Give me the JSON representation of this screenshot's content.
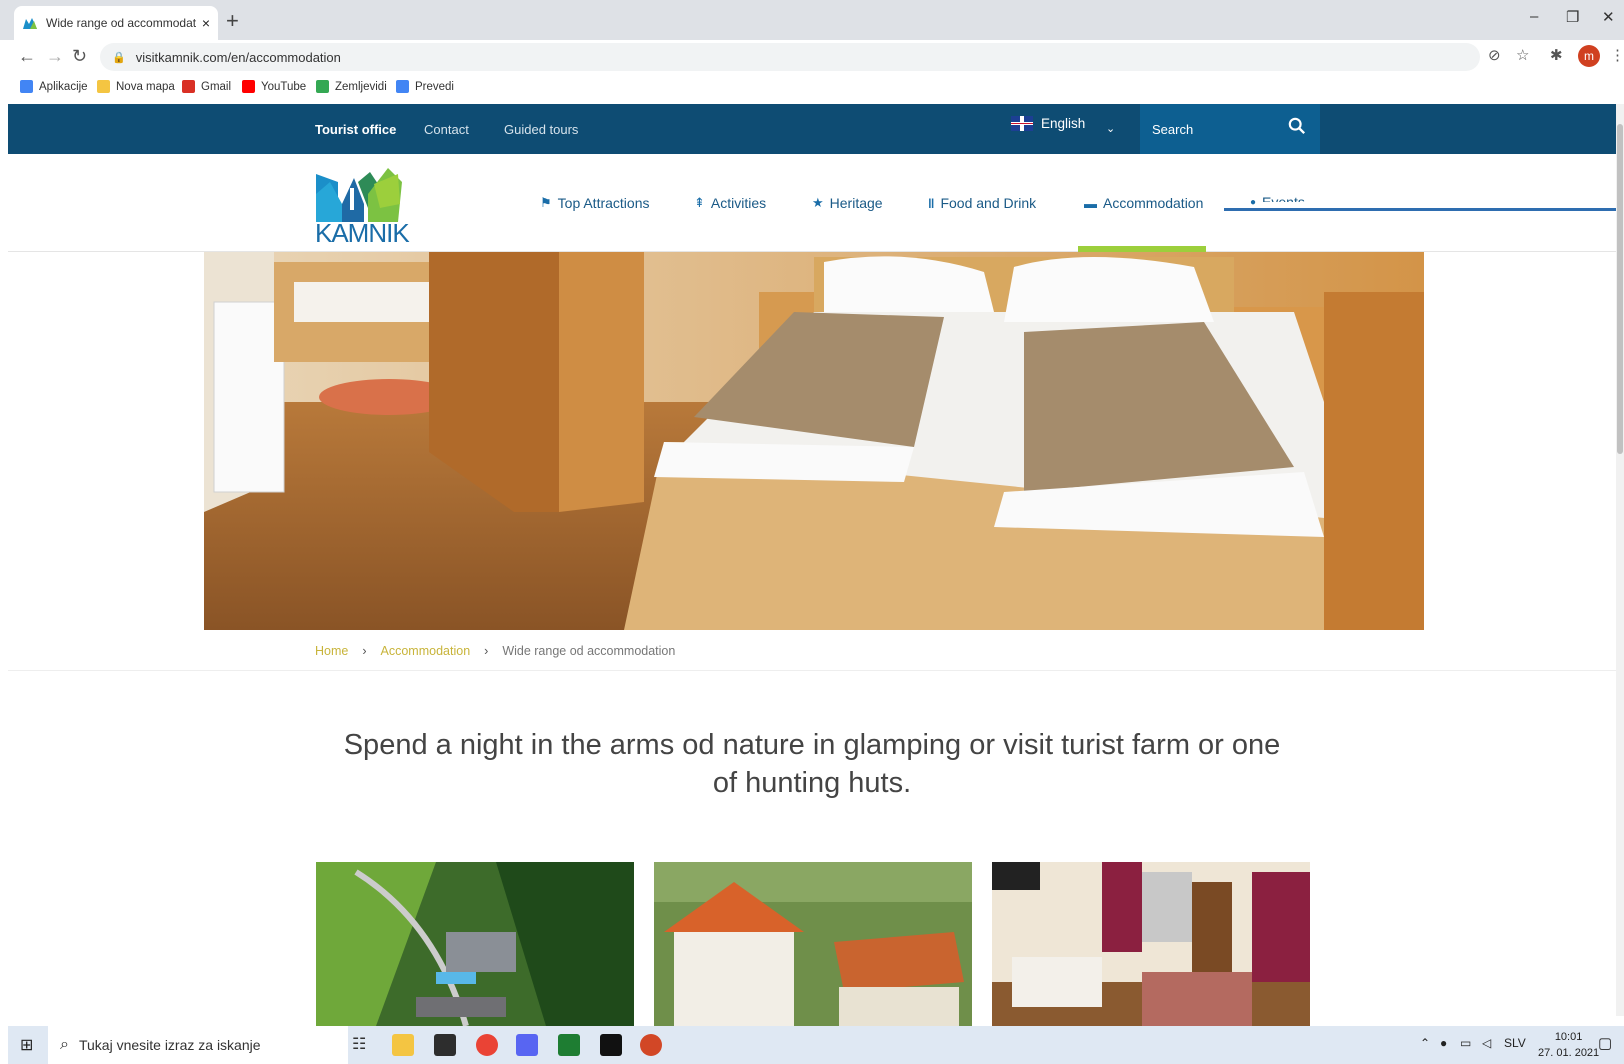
{
  "browser": {
    "tab_title": "Wide range od accommodation |",
    "tab_close": "×",
    "new_tab": "+",
    "url": "visitkamnik.com/en/accommodation",
    "profile_initial": "m",
    "window": {
      "minimize": "–",
      "restore": "❐",
      "close": "✕"
    }
  },
  "bookmarks": [
    {
      "label": "Aplikacije",
      "color": "#4285f4"
    },
    {
      "label": "Nova mapa",
      "color": "#f4c542"
    },
    {
      "label": "Gmail",
      "color": "#d93025"
    },
    {
      "label": "YouTube",
      "color": "#ff0000"
    },
    {
      "label": "Zemljevidi",
      "color": "#34a853"
    },
    {
      "label": "Prevedi",
      "color": "#4285f4"
    }
  ],
  "site": {
    "topnav": {
      "tourist_office": "Tourist office",
      "contact": "Contact",
      "guided_tours": "Guided tours"
    },
    "language": "English",
    "search_label": "Search",
    "logo_text": "KAMNIK",
    "mainnav": [
      {
        "label": "Top Attractions",
        "icon": "flag-icon",
        "glyph": "⚑"
      },
      {
        "label": "Activities",
        "icon": "signpost-icon",
        "glyph": "⇞"
      },
      {
        "label": "Heritage",
        "icon": "star-icon",
        "glyph": "★"
      },
      {
        "label": "Food and Drink",
        "icon": "cutlery-icon",
        "glyph": "🍴"
      },
      {
        "label": "Accommodation",
        "icon": "bed-icon",
        "glyph": "▬"
      },
      {
        "label": "Events",
        "icon": "marker-icon",
        "glyph": "●"
      }
    ],
    "breadcrumb": {
      "home": "Home",
      "section": "Accommodation",
      "current": "Wide range od accommodation",
      "separator": "›"
    },
    "lead": "Spend a night in the arms od nature in glamping or visit turist farm or one of hunting huts."
  },
  "taskbar": {
    "search_placeholder": "Tukaj vnesite izraz za iskanje",
    "language": "SLV",
    "time": "10:01",
    "date": "27. 01. 2021"
  },
  "colors": {
    "topbar": "#0e4c73",
    "search_bg": "#0d5f91",
    "link": "#1a5a87",
    "active_indicator": "#9ccf3c",
    "breadcrumb_link": "#c8b43a"
  }
}
